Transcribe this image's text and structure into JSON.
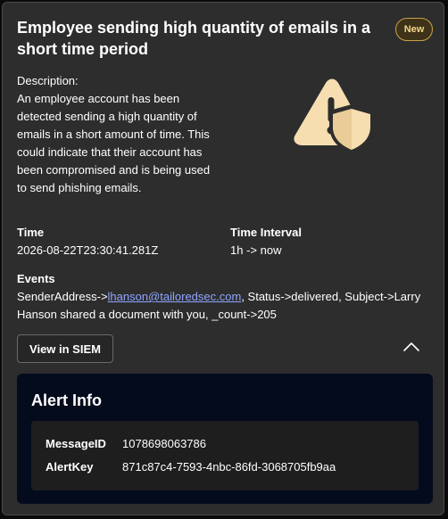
{
  "alert": {
    "title": "Employee sending high quantity of emails in a short time period",
    "status_badge": "New",
    "description_label": "Description:",
    "description": "An employee account has been detected sending a high quantity of emails in a short amount of time. This could indicate that their account has been compromised and is being used to send phishing emails.",
    "graphic_icon": "warning-shield-icon",
    "accent_color": "#f6deb0"
  },
  "fields": {
    "time_label": "Time",
    "time_value": "2026-08-22T23:30:41.281Z",
    "interval_label": "Time Interval",
    "interval_value": "1h -> now"
  },
  "events": {
    "label": "Events",
    "prefix": "SenderAddress->",
    "email_link": "lhanson@tailoredsec.com",
    "suffix": ", Status->delivered, Subject->Larry Hanson shared a document with you, _count->205"
  },
  "actions": {
    "siem_button": "View in SIEM",
    "collapse_icon": "chevron-up-icon"
  },
  "alert_info": {
    "title": "Alert Info",
    "message_id_label": "MessageID",
    "message_id_value": "1078698063786",
    "alert_key_label": "AlertKey",
    "alert_key_value": "871c87c4-7593-4nbc-86fd-3068705fb9aa"
  }
}
